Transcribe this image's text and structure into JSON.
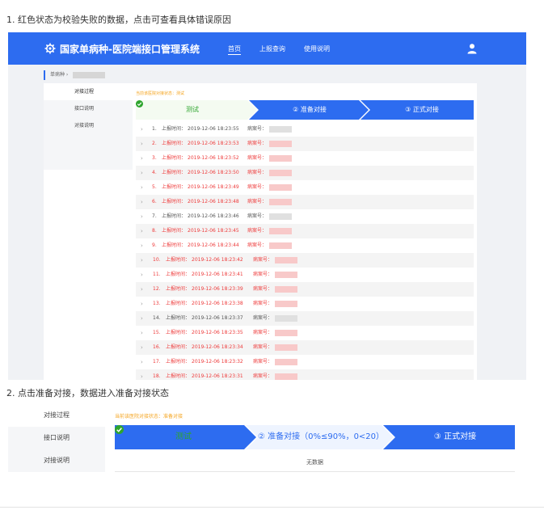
{
  "notes": {
    "note1": "1. 红色状态为校验失败的数据，点击可查看具体错误原因",
    "note2": "2. 点击准备对接，数据进入准备对接状态"
  },
  "colors": {
    "primary": "#2d6cf0",
    "error": "#ee3b3b",
    "warning": "#f5a623",
    "success": "#2ea52e"
  },
  "shot1": {
    "app_title": "国家单病种-医院端接口管理系统",
    "nav": [
      "首页",
      "上报查询",
      "使用说明"
    ],
    "breadcrumb": "单病种",
    "sidebar": [
      "对接过程",
      "接口说明",
      "对接说明"
    ],
    "status_text": "当前该医院对接状态：测试",
    "steps": [
      "测试",
      "② 准备对接",
      "③ 正式对接"
    ],
    "label_time": "上报时间：",
    "label_case": "病案号：",
    "rows": [
      {
        "idx": "1.",
        "time": "2019-12-06 18:23:55",
        "error": false
      },
      {
        "idx": "2.",
        "time": "2019-12-06 18:23:53",
        "error": true
      },
      {
        "idx": "3.",
        "time": "2019-12-06 18:23:52",
        "error": true
      },
      {
        "idx": "4.",
        "time": "2019-12-06 18:23:50",
        "error": true
      },
      {
        "idx": "5.",
        "time": "2019-12-06 18:23:49",
        "error": true
      },
      {
        "idx": "6.",
        "time": "2019-12-06 18:23:48",
        "error": true
      },
      {
        "idx": "7.",
        "time": "2019-12-06 18:23:46",
        "error": false
      },
      {
        "idx": "8.",
        "time": "2019-12-06 18:23:45",
        "error": true
      },
      {
        "idx": "9.",
        "time": "2019-12-06 18:23:44",
        "error": true
      },
      {
        "idx": "10.",
        "time": "2019-12-06 18:23:42",
        "error": true
      },
      {
        "idx": "11.",
        "time": "2019-12-06 18:23:41",
        "error": true
      },
      {
        "idx": "12.",
        "time": "2019-12-06 18:23:39",
        "error": true
      },
      {
        "idx": "13.",
        "time": "2019-12-06 18:23:38",
        "error": true
      },
      {
        "idx": "14.",
        "time": "2019-12-06 18:23:37",
        "error": false
      },
      {
        "idx": "15.",
        "time": "2019-12-06 18:23:35",
        "error": true
      },
      {
        "idx": "16.",
        "time": "2019-12-06 18:23:34",
        "error": true
      },
      {
        "idx": "17.",
        "time": "2019-12-06 18:23:32",
        "error": true
      },
      {
        "idx": "18.",
        "time": "2019-12-06 18:23:31",
        "error": true
      }
    ]
  },
  "shot2": {
    "sidebar": [
      "对接过程",
      "接口说明",
      "对接说明"
    ],
    "status_text": "当前该医院对接状态：准备对接",
    "steps": [
      "测试",
      "② 准备对接（0%≤90%，0<20）",
      "③ 正式对接"
    ],
    "empty_text": "无数据"
  }
}
